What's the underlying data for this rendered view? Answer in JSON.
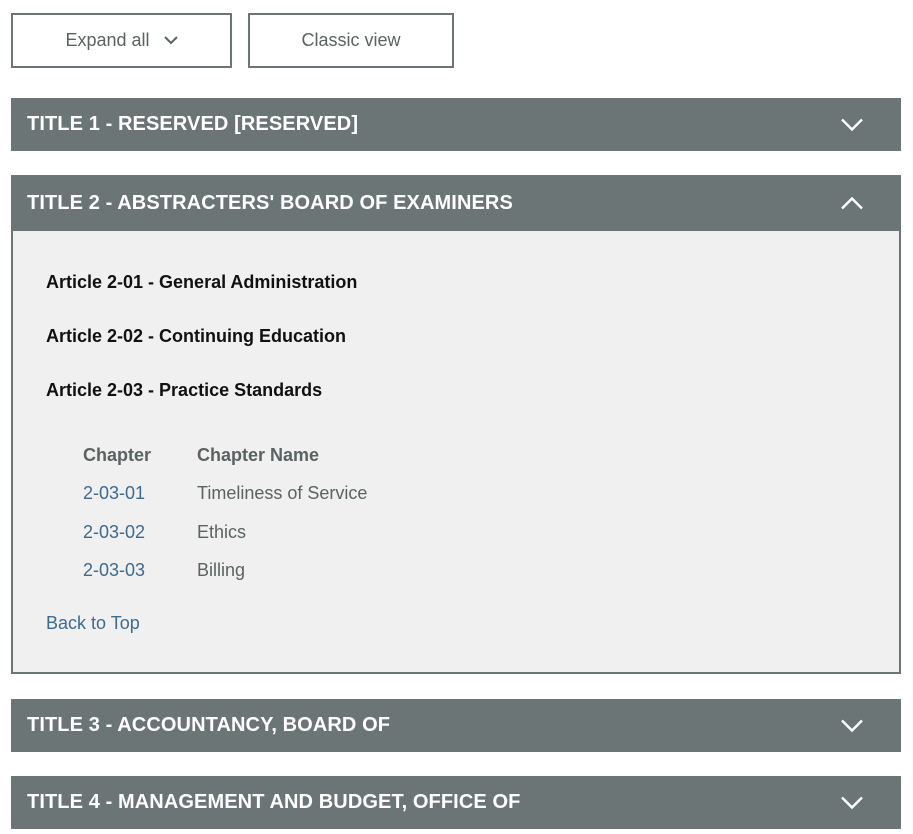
{
  "toolbar": {
    "expand_all_label": "Expand all",
    "classic_view_label": "Classic view"
  },
  "titles": [
    {
      "label": "TITLE 1 - RESERVED [RESERVED]",
      "expanded": false
    },
    {
      "label": "TITLE 2 - ABSTRACTERS' BOARD OF EXAMINERS",
      "expanded": true
    },
    {
      "label": "TITLE 3 - ACCOUNTANCY, BOARD OF",
      "expanded": false
    },
    {
      "label": "TITLE 4 - MANAGEMENT AND BUDGET, OFFICE OF",
      "expanded": false
    }
  ],
  "title2_panel": {
    "articles": [
      {
        "label": "Article 2-01 - General Administration"
      },
      {
        "label": "Article 2-02 - Continuing Education"
      },
      {
        "label": "Article 2-03 - Practice Standards"
      }
    ],
    "chapter_table": {
      "headers": [
        "Chapter",
        "Chapter Name"
      ],
      "rows": [
        {
          "chapter": "2-03-01",
          "name": "Timeliness of Service"
        },
        {
          "chapter": "2-03-02",
          "name": "Ethics"
        },
        {
          "chapter": "2-03-03",
          "name": "Billing"
        }
      ]
    },
    "back_to_top_label": "Back to Top"
  },
  "colors": {
    "title_bar_bg": "#6b7575",
    "panel_bg": "#f0f0f0",
    "link": "#3d6a8f"
  },
  "icons": {
    "collapsed": "chevron-down-icon",
    "expanded": "chevron-up-icon"
  }
}
